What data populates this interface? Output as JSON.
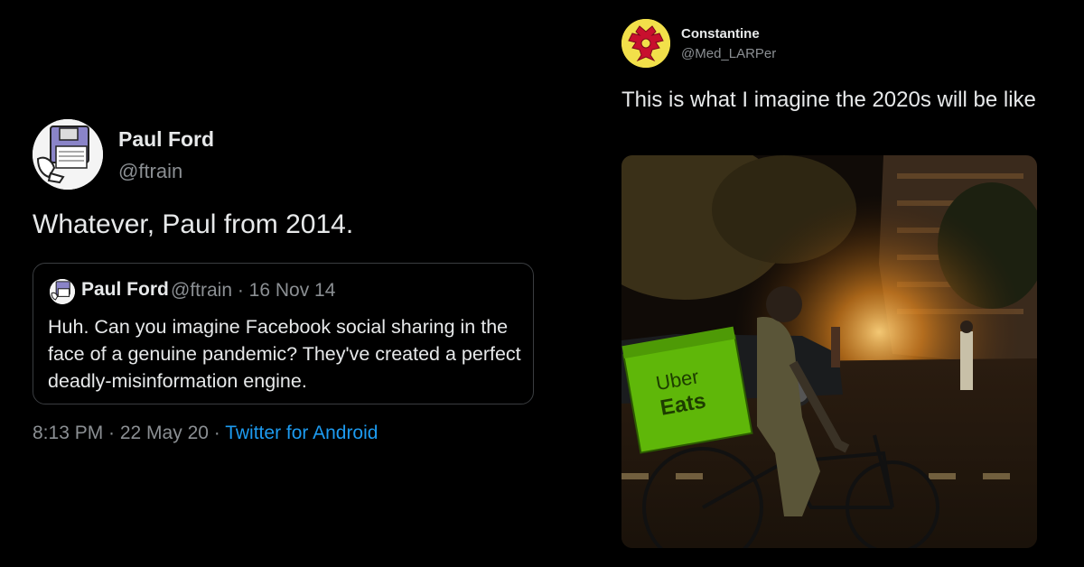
{
  "left_tweet": {
    "author_name": "Paul Ford",
    "author_handle": "@ftrain",
    "avatar_icon": "floppy-disk-avatar-icon",
    "text": "Whatever, Paul from 2014.",
    "quote": {
      "author_name": "Paul Ford",
      "meta": "@ftrain · 16 Nov 14",
      "text": "Huh. Can you imagine Facebook social sharing in the face of a genuine pandemic? They've created a perfect deadly-misinformation engine."
    },
    "timestamp": "8:13 PM · 22 May 20 · ",
    "source": "Twitter for Android"
  },
  "right_tweet": {
    "author_name": "Constantine",
    "author_handle": "@Med_LARPer",
    "avatar_icon": "double-headed-eagle-avatar-icon",
    "text": "This is what I imagine the 2020s will be like",
    "photo_text": {
      "bag_line1": "Uber",
      "bag_line2": "Eats"
    }
  },
  "colors": {
    "background": "#000000",
    "text": "#e7e9ea",
    "secondary": "#8b8f93",
    "link": "#1d9bf0",
    "quote_border": "#3a3d40",
    "uber_eats_green": "#5fb709"
  }
}
